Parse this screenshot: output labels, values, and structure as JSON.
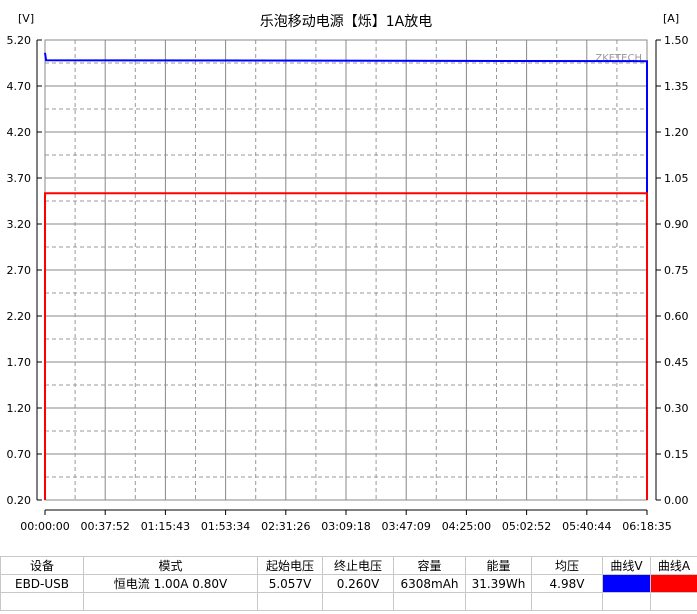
{
  "chart_data": {
    "type": "line",
    "title": "乐泡移动电源【烁】1A放电",
    "left_unit": "[V]",
    "right_unit": "[A]",
    "watermark": "ZKETECH",
    "y_left": {
      "min": 0.2,
      "max": 5.2,
      "ticks": [
        "5.20",
        "4.70",
        "4.20",
        "3.70",
        "3.20",
        "2.70",
        "2.20",
        "1.70",
        "1.20",
        "0.70",
        "0.20"
      ]
    },
    "y_right": {
      "min": 0,
      "max": 1.5,
      "ticks": [
        "1.50",
        "1.35",
        "1.20",
        "1.05",
        "0.90",
        "0.75",
        "0.60",
        "0.45",
        "0.30",
        "0.15",
        "0.00"
      ]
    },
    "x": {
      "min_s": 0,
      "max_s": 22715,
      "ticks": [
        "00:00:00",
        "00:37:52",
        "01:15:43",
        "01:53:34",
        "02:31:26",
        "03:09:18",
        "03:47:09",
        "04:25:00",
        "05:02:52",
        "05:40:44",
        "06:18:35"
      ]
    },
    "grid": true,
    "series": [
      {
        "name": "曲线V",
        "axis": "left",
        "color": "#0000ff",
        "points": [
          [
            0,
            5.057
          ],
          [
            0,
            5.06
          ],
          [
            40,
            4.98
          ],
          [
            22715,
            4.97
          ],
          [
            22715,
            0.3
          ]
        ]
      },
      {
        "name": "曲线A",
        "axis": "right",
        "color": "#ff0000",
        "points": [
          [
            0,
            0
          ],
          [
            0,
            1.0
          ],
          [
            22715,
            1.0
          ],
          [
            22715,
            0
          ]
        ]
      }
    ]
  },
  "table": {
    "headers": [
      "设备",
      "模式",
      "起始电压",
      "终止电压",
      "容量",
      "能量",
      "均压",
      "曲线V",
      "曲线A"
    ],
    "row": [
      "EBD-USB",
      "恒电流 1.00A 0.80V",
      "5.057V",
      "0.260V",
      "6308mAh",
      "31.39Wh",
      "4.98V"
    ],
    "colors": {
      "v": "#0000ff",
      "a": "#ff0000"
    }
  }
}
